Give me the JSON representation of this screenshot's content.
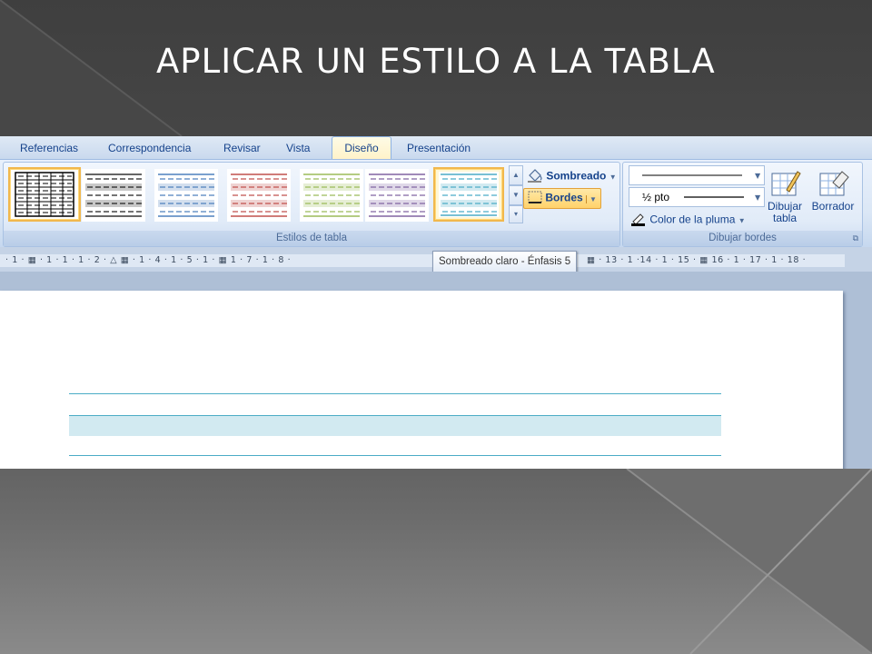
{
  "slide": {
    "title": "APLICAR UN ESTILO A LA TABLA"
  },
  "ribbon": {
    "tabs": [
      {
        "label": "Referencias",
        "active": false
      },
      {
        "label": "Correspondencia",
        "active": false
      },
      {
        "label": "Revisar",
        "active": false
      },
      {
        "label": "Vista",
        "active": false
      },
      {
        "label": "Diseño",
        "active": true
      },
      {
        "label": "Presentación",
        "active": false
      }
    ],
    "table_styles": {
      "group_label": "Estilos de tabla",
      "styles": [
        {
          "name": "table-grid",
          "color": "#000000",
          "selected": false
        },
        {
          "name": "light-shading",
          "color": "#404040",
          "selected": false
        },
        {
          "name": "light-shading-accent-1",
          "color": "#4f81bd",
          "selected": false
        },
        {
          "name": "light-shading-accent-2",
          "color": "#c0504d",
          "selected": false
        },
        {
          "name": "light-shading-accent-3",
          "color": "#9bbb59",
          "selected": false
        },
        {
          "name": "light-shading-accent-4",
          "color": "#8064a2",
          "selected": false
        },
        {
          "name": "light-shading-accent-5",
          "color": "#4bacc6",
          "selected": true
        }
      ],
      "shading_label": "Sombreado",
      "borders_label": "Bordes"
    },
    "draw_borders": {
      "group_label": "Dibujar bordes",
      "line_weight": "½ pto",
      "pen_color_label": "Color de la pluma",
      "draw_table_label_1": "Dibujar",
      "draw_table_label_2": "tabla",
      "eraser_label": "Borrador"
    }
  },
  "ruler": {
    "markings": "· 1 · ▦ · 1 · 1 · 1 · 2 · △ ▦ · 1 · 4 · 1 · 5 · 1 · ▦ 1 · 7 · 1 · 8 ·",
    "markings_right": "▦ · 13 · 1 ·14 · 1 · 15 · ▦ 16 · 1 · 17 · 1 · 18 ·"
  },
  "tooltip": {
    "text": "Sombreado claro - Énfasis 5"
  },
  "colors": {
    "accent_5": "#4bacc6",
    "accent_5_light": "#d2eaf1",
    "selection_border": "#f1b84d",
    "ribbon_text": "#15428b"
  }
}
